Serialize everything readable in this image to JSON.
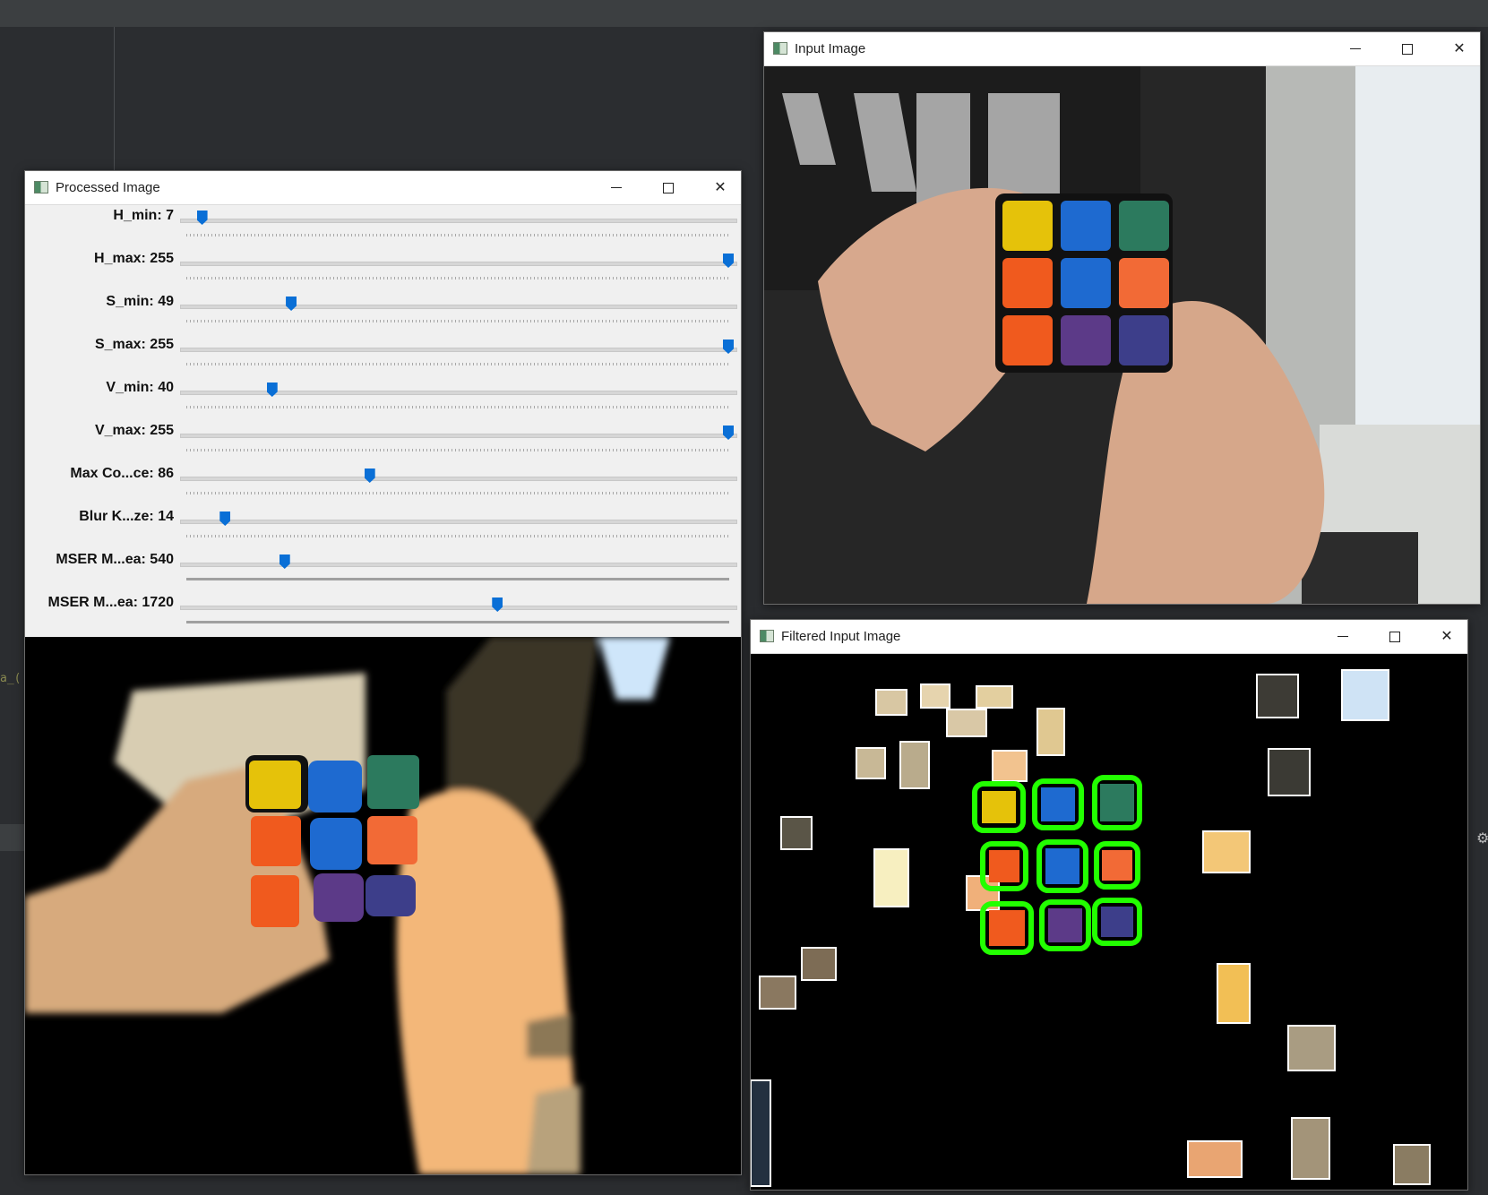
{
  "windows": {
    "processed": {
      "title": "Processed Image",
      "trackbars": [
        {
          "label": "H_min: 7",
          "value": 7,
          "max": 255
        },
        {
          "label": "H_max: 255",
          "value": 255,
          "max": 255
        },
        {
          "label": "S_min: 49",
          "value": 49,
          "max": 255
        },
        {
          "label": "S_max: 255",
          "value": 255,
          "max": 255
        },
        {
          "label": "V_min: 40",
          "value": 40,
          "max": 255
        },
        {
          "label": "V_max: 255",
          "value": 255,
          "max": 255
        },
        {
          "label": "Max Co...ce: 86",
          "value": 86,
          "max": 255
        },
        {
          "label": "Blur K...ze: 14",
          "value": 14,
          "max": 200
        },
        {
          "label": "MSER M...ea: 540",
          "value": 540,
          "max": 3000
        },
        {
          "label": "MSER M...ea: 1720",
          "value": 1720,
          "max": 3000
        }
      ]
    },
    "input": {
      "title": "Input Image"
    },
    "filtered": {
      "title": "Filtered Input Image"
    }
  },
  "ide": {
    "fragment": "a_("
  },
  "icons": {
    "app": "window-app-icon",
    "min": "minimize-icon",
    "max": "maximize-icon",
    "close": "close-icon",
    "gear": "gear-icon"
  },
  "colors": {
    "cube_yellow": "#e5c20a",
    "cube_blue": "#1e6ad0",
    "cube_green": "#2c7a5e",
    "cube_orange": "#f05a1e",
    "cube_purple": "#5c3a88",
    "cube_indigo": "#3d3e8a",
    "detect_green": "#22ff00",
    "slider_thumb": "#0a6fd6"
  }
}
